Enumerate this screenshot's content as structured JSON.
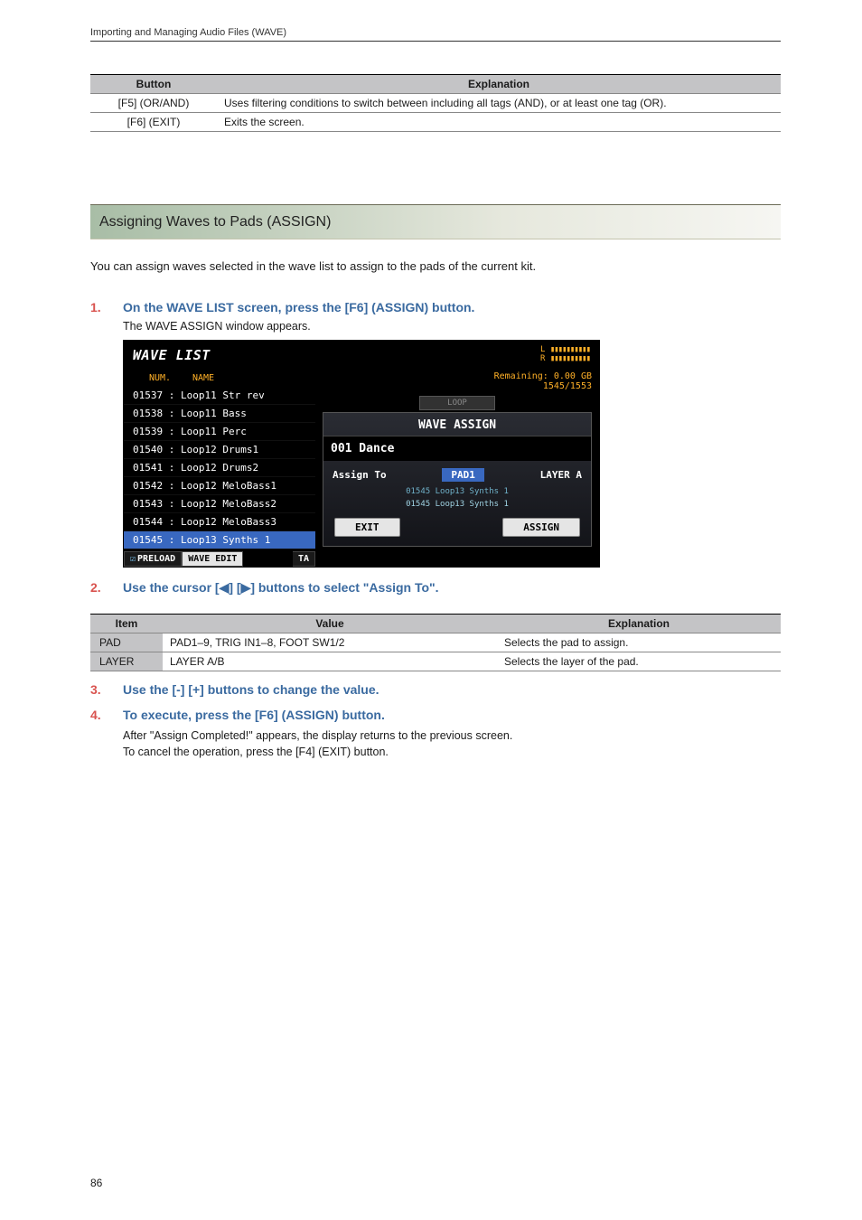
{
  "header": "Importing and Managing Audio Files (WAVE)",
  "table1": {
    "head": [
      "Button",
      "Explanation"
    ],
    "rows": [
      [
        "[F5] (OR/AND)",
        "Uses filtering conditions to switch between including all tags (AND), or at least one tag (OR)."
      ],
      [
        "[F6] (EXIT)",
        "Exits the screen."
      ]
    ]
  },
  "section_title": "Assigning Waves to Pads (ASSIGN)",
  "intro": "You can assign waves selected in the wave list to assign to the pads of the current kit.",
  "steps": {
    "s1_num": "1.",
    "s1": "On the WAVE LIST screen, press the [F6] (ASSIGN) button.",
    "s1_sub": "The WAVE ASSIGN window appears.",
    "s2_num": "2.",
    "s2": "Use the cursor [◀] [▶] buttons to select \"Assign To\".",
    "s3_num": "3.",
    "s3": "Use the [-] [+] buttons to change the value.",
    "s4_num": "4.",
    "s4": "To execute, press the [F6] (ASSIGN) button.",
    "after1": "After \"Assign Completed!\" appears, the display returns to the previous screen.",
    "after2": "To cancel the operation, press the [F4] (EXIT) button."
  },
  "screenshot": {
    "title": "WAVE LIST",
    "meter_l": "L",
    "meter_r": "R",
    "bars": "▮▮▮▮▮▮▮▮▮▮",
    "headers": {
      "num": "NUM.",
      "name": "NAME"
    },
    "rows": [
      "01537 : Loop11 Str rev",
      "01538 : Loop11 Bass",
      "01539 : Loop11 Perc",
      "01540 : Loop12 Drums1",
      "01541 : Loop12 Drums2",
      "01542 : Loop12 MeloBass1",
      "01543 : Loop12 MeloBass2",
      "01544 : Loop12 MeloBass3",
      "01545 : Loop13 Synths 1"
    ],
    "remaining1": "Remaining: 0.00 GB",
    "remaining2": "1545/1553",
    "loop": "LOOP",
    "panel_title": "WAVE ASSIGN",
    "panel_sub": "001 Dance",
    "assign_to": "Assign To",
    "pad": "PAD1",
    "layer": "LAYER A",
    "mini1": "01545 Loop13 Synths 1",
    "mini2": "01545 Loop13 Synths 1",
    "btn_exit": "EXIT",
    "btn_assign": "ASSIGN",
    "tab_preload": "PRELOAD",
    "tab_waveedit": "WAVE EDIT",
    "tab_tag": "TA"
  },
  "table2": {
    "head": [
      "Item",
      "Value",
      "Explanation"
    ],
    "rows": [
      [
        "PAD",
        "PAD1–9, TRIG IN1–8, FOOT SW1/2",
        "Selects the pad to assign."
      ],
      [
        "LAYER",
        "LAYER A/B",
        "Selects the layer of the pad."
      ]
    ]
  },
  "page_number": "86"
}
